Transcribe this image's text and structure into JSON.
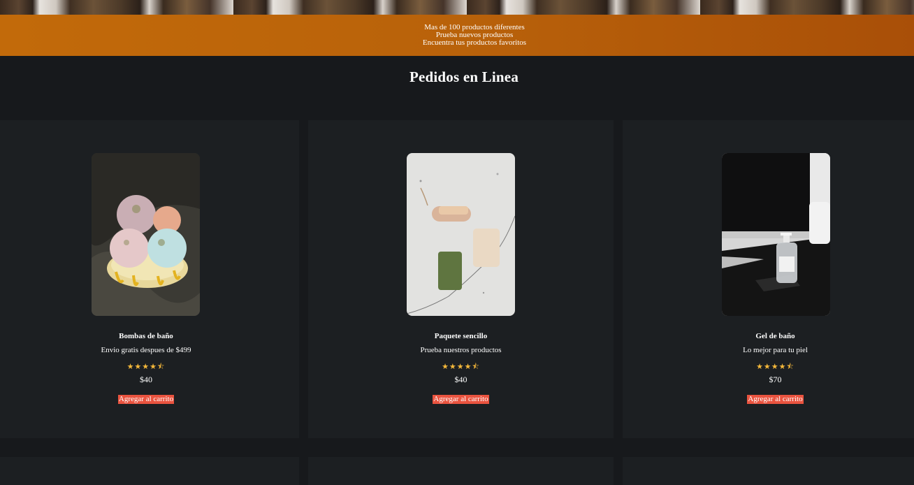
{
  "promo": {
    "lines": [
      "Mas de 100 productos diferentes",
      "Prueba nuevos productos",
      "Encuentra tus productos favoritos"
    ]
  },
  "page_title": "Pedidos en Linea",
  "products": [
    {
      "name": "Bombas de baño",
      "desc": "Envio gratis despues de $499",
      "stars": "★★★★⯪",
      "price": "$40",
      "button": "Agregar al carrito"
    },
    {
      "name": "Paquete sencillo",
      "desc": "Prueba nuestros productos",
      "stars": "★★★★⯪",
      "price": "$40",
      "button": "Agregar al carrito"
    },
    {
      "name": "Gel de baño",
      "desc": "Lo mejor para tu piel",
      "stars": "★★★★⯪",
      "price": "$70",
      "button": "Agregar al carrito"
    }
  ],
  "rating_value": 4.5,
  "colors": {
    "accent": "#e9533f",
    "band": "#b9620a",
    "star": "#f5b83a",
    "card": "#1c1f22",
    "bg": "#17191c"
  }
}
